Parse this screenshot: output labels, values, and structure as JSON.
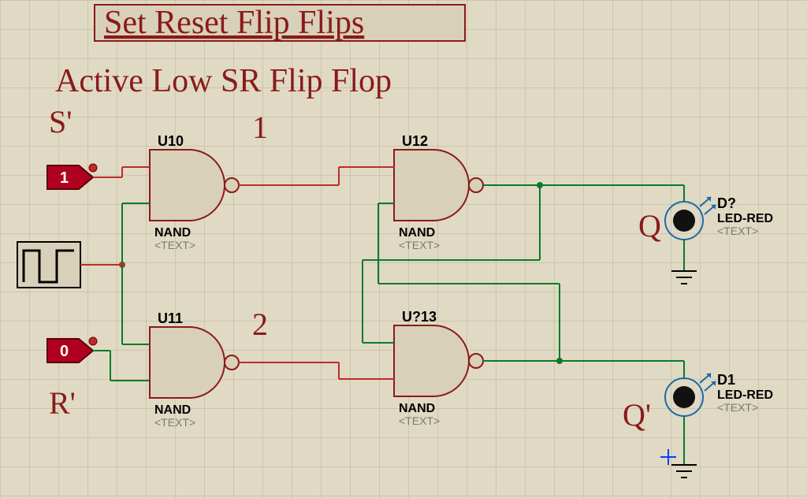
{
  "title": "Set Reset Flip Flips",
  "subtitle": "Active Low SR Flip Flop",
  "labels": {
    "s": "S'",
    "r": "R'",
    "q": "Q",
    "qbar": "Q'",
    "one": "1",
    "two": "2"
  },
  "gates": {
    "u10": {
      "ref": "U10",
      "type": "NAND",
      "tmpl": "<TEXT>"
    },
    "u11": {
      "ref": "U11",
      "type": "NAND",
      "tmpl": "<TEXT>"
    },
    "u12": {
      "ref": "U12",
      "type": "NAND",
      "tmpl": "<TEXT>"
    },
    "u13": {
      "ref": "U?13",
      "type": "NAND",
      "tmpl": "<TEXT>"
    }
  },
  "inputs": {
    "s_state": "1",
    "r_state": "0"
  },
  "leds": {
    "d_top": {
      "ref": "D?",
      "type": "LED-RED",
      "tmpl": "<TEXT>"
    },
    "d_bot": {
      "ref": "D1",
      "type": "LED-RED",
      "tmpl": "<TEXT>"
    }
  }
}
